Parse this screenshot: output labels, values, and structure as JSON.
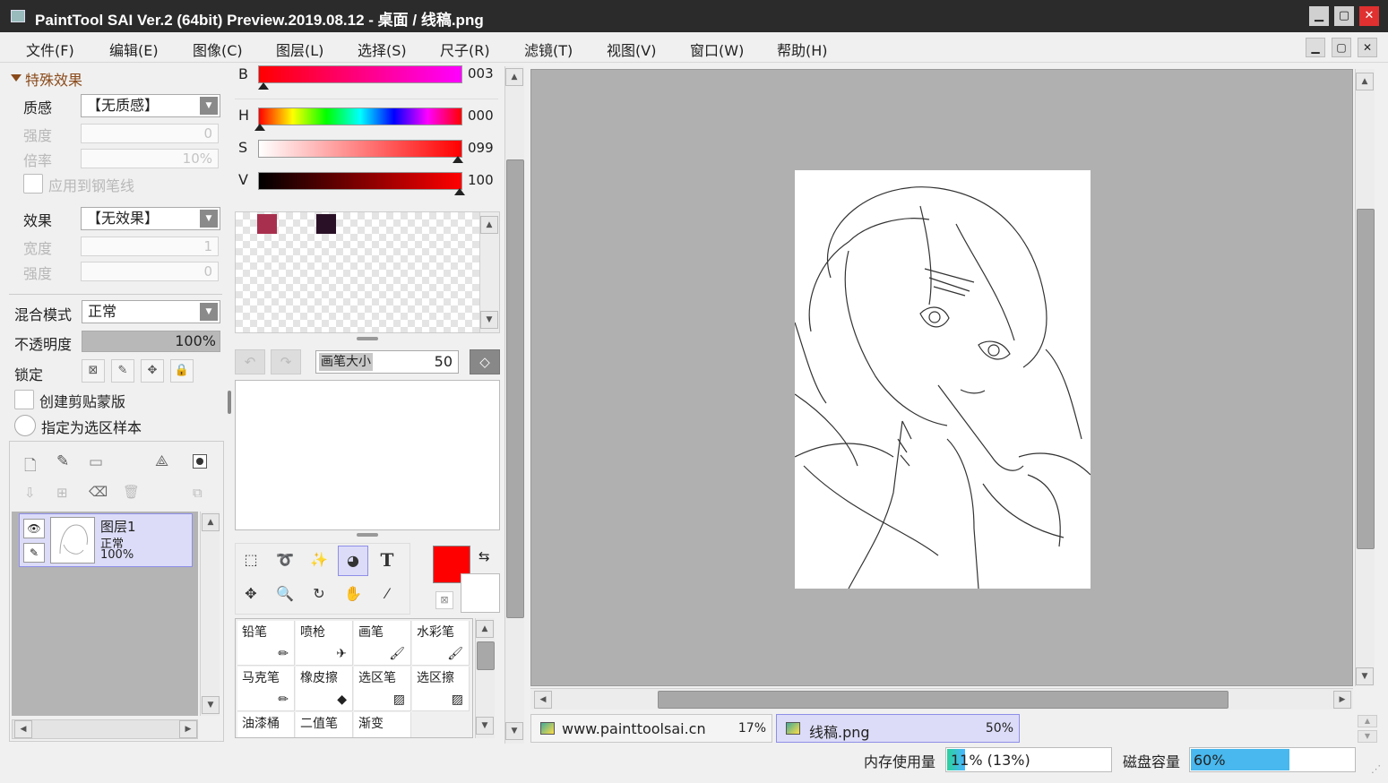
{
  "window": {
    "title": "PaintTool SAI Ver.2 (64bit) Preview.2019.08.12 - 桌面 / 线稿.png",
    "min": "▁",
    "max": "▢",
    "close": "✕"
  },
  "menu": [
    "文件(F)",
    "编辑(E)",
    "图像(C)",
    "图层(L)",
    "选择(S)",
    "尺子(R)",
    "滤镜(T)",
    "视图(V)",
    "窗口(W)",
    "帮助(H)"
  ],
  "effects": {
    "header": "特殊效果",
    "texture_label": "质感",
    "texture_value": "【无质感】",
    "strength_label": "强度",
    "strength_value": "0",
    "scale_label": "倍率",
    "scale_value": "10%",
    "apply_pen_label": "应用到钢笔线",
    "effect_label": "效果",
    "effect_value": "【无效果】",
    "width_label": "宽度",
    "width_value": "1",
    "strength2_label": "强度",
    "strength2_value": "0"
  },
  "layer_props": {
    "blend_label": "混合模式",
    "blend_value": "正常",
    "opacity_label": "不透明度",
    "opacity_value": "100%",
    "opacity": 1.0,
    "lock_label": "锁定",
    "clip_label": "创建剪贴蒙版",
    "sel_sample_label": "指定为选区样本"
  },
  "layers": [
    {
      "name": "图层1",
      "mode": "正常",
      "opacity": "100%"
    }
  ],
  "color": {
    "b_label": "B",
    "b_value": "003",
    "h_label": "H",
    "h_value": "000",
    "s_label": "S",
    "s_value": "099",
    "v_label": "V",
    "v_value": "100",
    "swatch1": "#a8304e",
    "swatch2": "#2a1026",
    "primary": "#ff0000",
    "secondary": "#ffffff"
  },
  "brush_size": {
    "label": "画笔大小",
    "value": "50"
  },
  "brushes": [
    "铅笔",
    "喷枪",
    "画笔",
    "水彩笔",
    "马克笔",
    "橡皮擦",
    "选区笔",
    "选区擦",
    "油漆桶",
    "二值笔",
    "渐变"
  ],
  "tabs": [
    {
      "name": "www.painttoolsai.cn",
      "zoom": "17%"
    },
    {
      "name": "线稿.png",
      "zoom": "50%"
    }
  ],
  "status": {
    "mem_label": "内存使用量",
    "mem_value": "11% (13%)",
    "mem": 0.11,
    "disk_label": "磁盘容量",
    "disk_value": "60%",
    "disk": 0.6
  },
  "icons": {
    "eye": "👁",
    "pen": "✎",
    "text_tool": "T"
  }
}
